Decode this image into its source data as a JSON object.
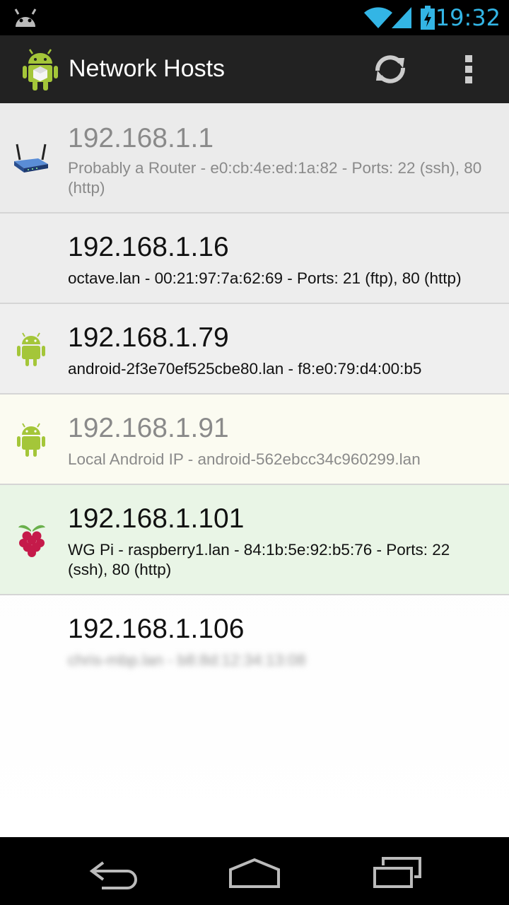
{
  "status_bar": {
    "time": "19:32",
    "icons": [
      "android-notification-icon",
      "wifi-icon",
      "signal-icon",
      "battery-charging-icon"
    ]
  },
  "action_bar": {
    "title": "Network Hosts",
    "actions": [
      "refresh-icon",
      "overflow-menu-icon"
    ]
  },
  "hosts": [
    {
      "ip": "192.168.1.1",
      "desc": "Probably a Router - e0:cb:4e:ed:1a:82 - Ports: 22 (ssh), 80 (http)",
      "icon": "router-icon"
    },
    {
      "ip": "192.168.1.16",
      "desc": "octave.lan - 00:21:97:7a:62:69 - Ports: 21 (ftp), 80 (http)",
      "icon": ""
    },
    {
      "ip": "192.168.1.79",
      "desc": "android-2f3e70ef525cbe80.lan - f8:e0:79:d4:00:b5",
      "icon": "android-icon"
    },
    {
      "ip": "192.168.1.91",
      "desc": "Local Android IP - android-562ebcc34c960299.lan",
      "icon": "android-icon"
    },
    {
      "ip": "192.168.1.101",
      "desc": "WG Pi - raspberry1.lan - 84:1b:5e:92:b5:76 - Ports: 22 (ssh), 80 (http)",
      "icon": "raspberry-pi-icon"
    },
    {
      "ip": "192.168.1.106",
      "desc": "chris-mbp.lan - b8:8d:12:34:13:08",
      "icon": ""
    }
  ],
  "colors": {
    "accent": "#33b5e5",
    "android_green": "#a4c639",
    "local_highlight": "#fbfbf1",
    "pi_highlight": "#e9f5e6"
  },
  "nav_bar": [
    "back-icon",
    "home-icon",
    "recent-apps-icon"
  ]
}
